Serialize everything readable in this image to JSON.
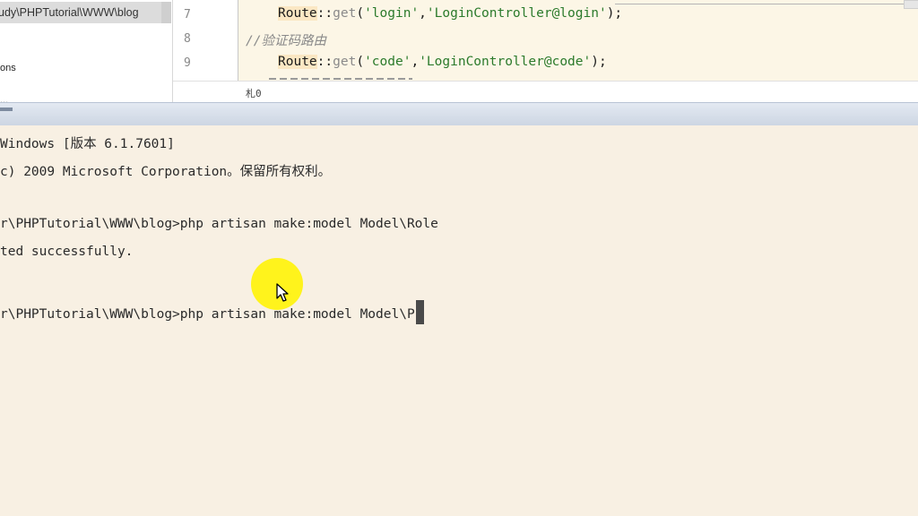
{
  "sidebar": {
    "path": "udy\\PHPTutorial\\WWW\\blog",
    "item": "ons",
    "item_partial": "..."
  },
  "editor": {
    "lines": [
      {
        "num": "7",
        "cls": "Route",
        "sep": "::",
        "fn": "get",
        "open": "(",
        "arg1": "'login'",
        "comma": ",",
        "arg2": "'LoginController@login'",
        "close": ");"
      },
      {
        "num": "8",
        "comment": "//验证码路由"
      },
      {
        "num": "9",
        "cls": "Route",
        "sep": "::",
        "fn": "get",
        "open": "(",
        "arg1": "'code'",
        "comma": ",",
        "arg2": "'LoginController@code'",
        "close": ");"
      }
    ],
    "status": "札0"
  },
  "terminal": {
    "lines": [
      "Windows [版本 6.1.7601]",
      "c) 2009 Microsoft Corporation。保留所有权利。",
      "",
      "r\\PHPTutorial\\WWW\\blog>php artisan make:model Model\\Role",
      "ted successfully.",
      "",
      "r\\PHPTutorial\\WWW\\blog>php artisan make:model Model\\P"
    ]
  },
  "colors": {
    "terminal_bg": "#f8f0e3",
    "editor_bg": "#fcf6e6",
    "string": "#2b7a2b",
    "highlight": "#fff200"
  }
}
